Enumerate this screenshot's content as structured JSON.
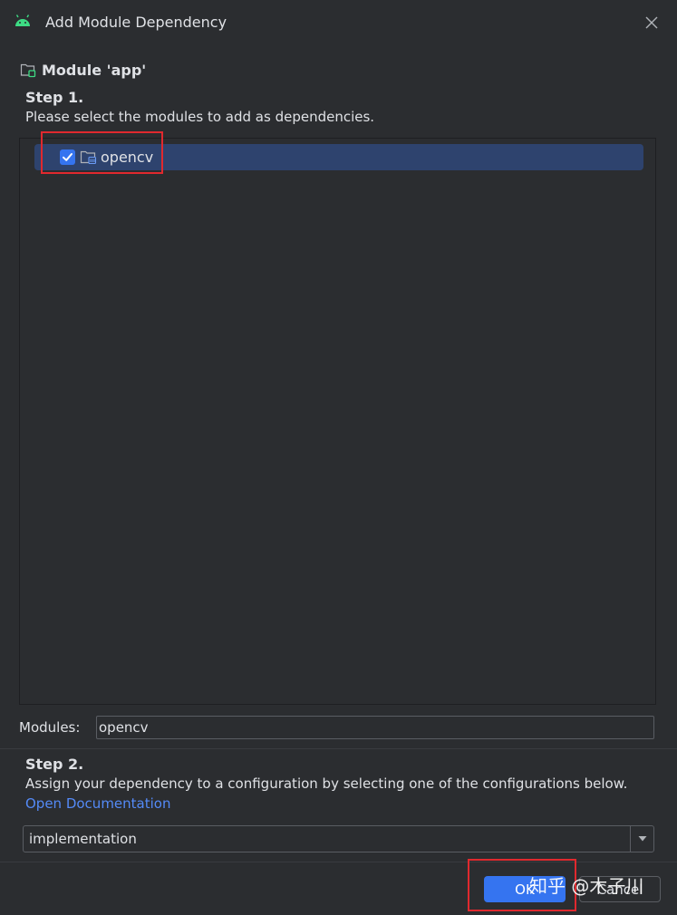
{
  "window": {
    "title": "Add Module Dependency"
  },
  "module": {
    "title": "Module 'app'"
  },
  "step1": {
    "heading": "Step 1.",
    "description": "Please select the modules to add as dependencies.",
    "items": [
      {
        "label": "opencv",
        "checked": true,
        "selected": true
      }
    ]
  },
  "modules_field": {
    "label": "Modules:",
    "value": "opencv"
  },
  "step2": {
    "heading": "Step 2.",
    "description": "Assign your dependency to a configuration by selecting one of the configurations below.",
    "link": "Open Documentation"
  },
  "configuration": {
    "selected": "implementation"
  },
  "buttons": {
    "ok": "OK",
    "cancel": "Cancel"
  },
  "watermark": "知乎 @木子川",
  "colors": {
    "background": "#2b2d30",
    "accent": "#3574f0",
    "selection": "#2e436e",
    "link": "#548af7",
    "annotation": "#e0292e",
    "android_green": "#3ddc84"
  },
  "icons": {
    "title": "android-icon",
    "close": "close-icon",
    "module": "module-folder-icon",
    "checkbox": "checkmark-icon",
    "row": "library-folder-icon",
    "dropdown": "chevron-down-icon"
  }
}
